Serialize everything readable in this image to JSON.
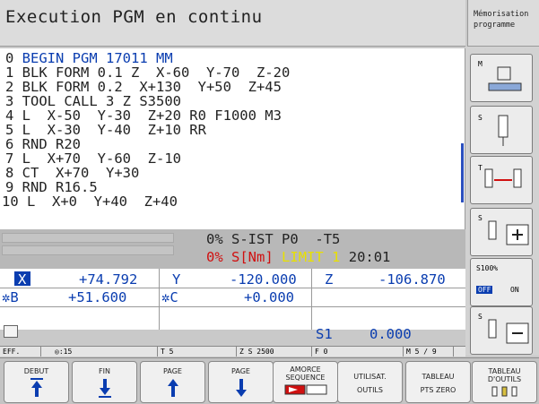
{
  "header": {
    "title": "Execution PGM en continu"
  },
  "mode": {
    "line1": "Mémorisation",
    "line2": "programme"
  },
  "program": {
    "lines": [
      {
        "n": "0",
        "t": " BEGIN PGM 17011 MM"
      },
      {
        "n": "1",
        "t": " BLK FORM 0.1 Z  X-60  Y-70  Z-20"
      },
      {
        "n": "2",
        "t": " BLK FORM 0.2  X+130  Y+50  Z+45"
      },
      {
        "n": "3",
        "t": " TOOL CALL 3 Z S3500"
      },
      {
        "n": "4",
        "t": " L  X-50  Y-30  Z+20 R0 F1000 M3"
      },
      {
        "n": "5",
        "t": " L  X-30  Y-40  Z+10 RR"
      },
      {
        "n": "6",
        "t": " RND R20"
      },
      {
        "n": "7",
        "t": " L  X+70  Y-60  Z-10"
      },
      {
        "n": "8",
        "t": " CT  X+70  Y+30"
      },
      {
        "n": "9",
        "t": " RND R16.5"
      },
      {
        "n": "10",
        "t": " L  X+0  Y+40  Z+40"
      }
    ]
  },
  "status": {
    "s_ist_pct": "0%",
    "s_ist": "S-IST",
    "p0": "P0",
    "t5": "-T5",
    "s_nm_pct": "0%",
    "s_nm": "S[Nm]",
    "limit": "LIMIT",
    "limit_n": "1",
    "time": "20:01"
  },
  "axes": {
    "x_label": "X",
    "x_val": "+74.792",
    "y_label": "Y",
    "y_val": "-120.000",
    "z_label": "Z",
    "z_val": "-106.870",
    "b_label": "✲B",
    "b_val": "+51.600",
    "c_label": "✲C",
    "c_val": "+0.000",
    "s1_label": "S1",
    "s1_val": "0.000"
  },
  "bottom_strip": {
    "eff": "EFF.",
    "f15": "15",
    "t5": "T 5",
    "zs": "Z S 2500",
    "f0": "F 0",
    "m": "M 5 / 9"
  },
  "side": {
    "m_label": "M",
    "s_label1": "S",
    "t_label": "T",
    "s_label2": "S",
    "pct": "S100%",
    "off": "OFF",
    "on": "ON",
    "s_label3": "S"
  },
  "softkeys": {
    "debut": "DEBUT",
    "fin": "FIN",
    "page1": "PAGE",
    "page2": "PAGE",
    "amorce1": "AMORCE",
    "amorce2": "SEQUENCE",
    "util1": "UTILISAT.",
    "util2": "OUTILS",
    "tab1": "TABLEAU",
    "tab2": "PTS ZERO",
    "tabd1": "TABLEAU",
    "tabd2": "D'OUTILS"
  },
  "colors": {
    "accent_blue": "#0a3db0",
    "limit_yellow": "#e8e000",
    "alert_red": "#d01010"
  }
}
